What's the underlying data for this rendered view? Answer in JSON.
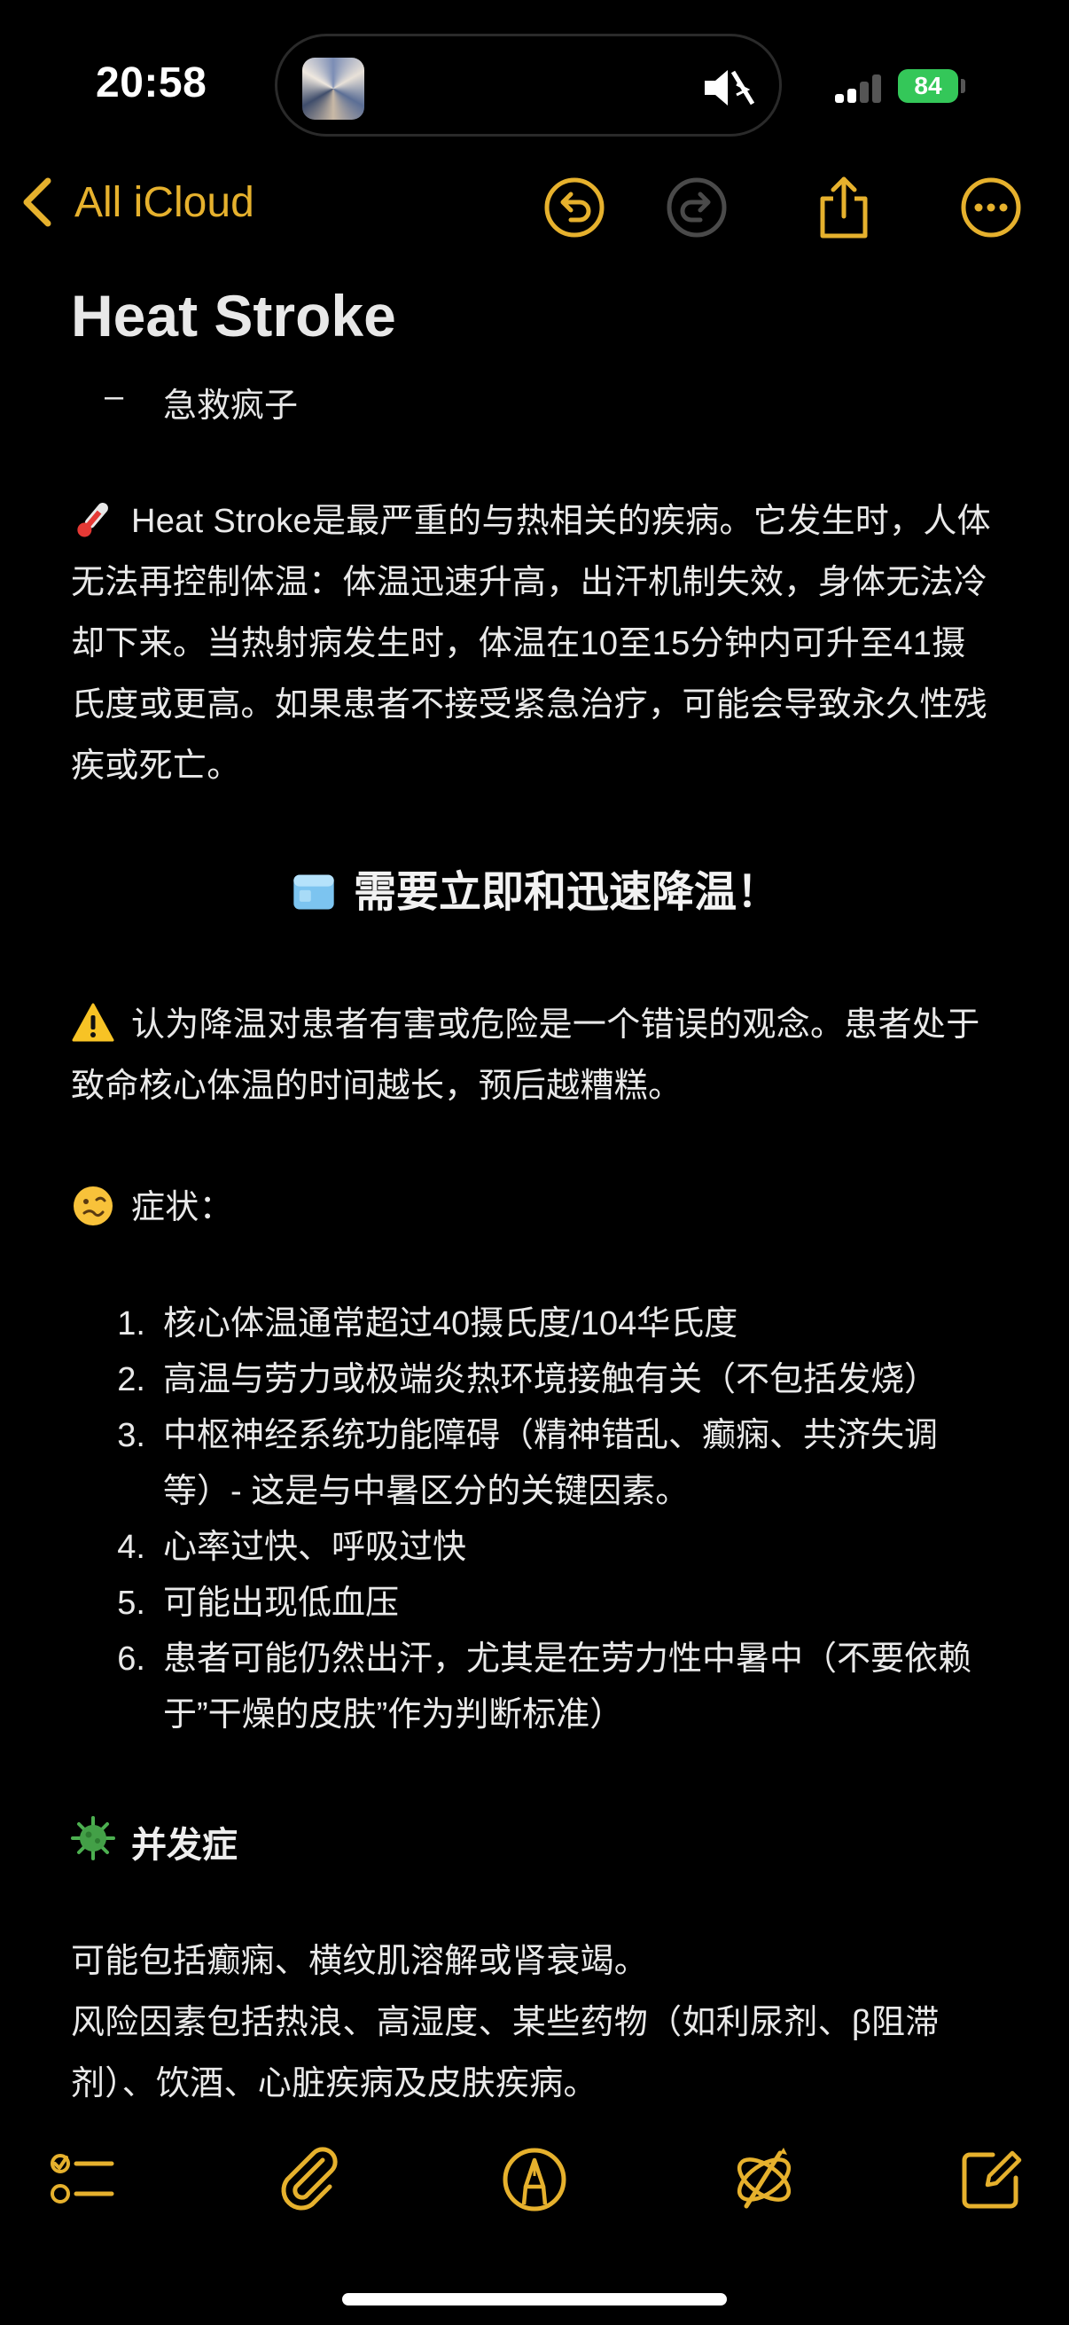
{
  "status_bar": {
    "time": "20:58",
    "battery": "84",
    "battery_color": "#34c759",
    "icons": [
      "mute-bell-icon",
      "bluetooth-icon",
      "cellular-signal-icon",
      "battery-charging-icon"
    ]
  },
  "nav": {
    "back_label": "All iCloud",
    "accent_color": "#e6b12d",
    "buttons": [
      "undo-icon",
      "redo-icon",
      "share-icon",
      "more-icon"
    ]
  },
  "note": {
    "title": "Heat Stroke",
    "subtitle_dash": "–",
    "subtitle": "急救疯子",
    "intro": "Heat Stroke是最严重的与热相关的疾病。它发生时，人体无法再控制体温：体温迅速升高，出汗机制失效，身体无法冷却下来。当热射病发生时，体温在10至15分钟内可升至41摄氏度或更高。如果患者不接受紧急治疗，可能会导致永久性残疾或死亡。",
    "intro_emoji": "thermometer-emoji",
    "cooling_heading": "需要立即和迅速降温！",
    "cooling_emoji": "ice-cube-emoji",
    "warning": "认为降温对患者有害或危险是一个错误的观念。患者处于致命核心体温的时间越长，预后越糟糕。",
    "warning_emoji": "warning-emoji",
    "symptoms_label": "症状：",
    "symptoms_emoji": "woozy-face-emoji",
    "symptoms": [
      {
        "num": "1.",
        "text": "核心体温通常超过40摄氏度/104华氏度"
      },
      {
        "num": "2.",
        "text": "高温与劳力或极端炎热环境接触有关（不包括发烧）"
      },
      {
        "num": "3.",
        "text": "中枢神经系统功能障碍（精神错乱、癫痫、共济失调等）- 这是与中暑区分的关键因素。"
      },
      {
        "num": "4.",
        "text": "心率过快、呼吸过快"
      },
      {
        "num": "5.",
        "text": "可能出现低血压"
      },
      {
        "num": "6.",
        "text": "患者可能仍然出汗，尤其是在劳力性中暑中（不要依赖于”干燥的皮肤”作为判断标准）"
      }
    ],
    "complications_label": "并发症",
    "complications_emoji": "microbe-emoji",
    "complications_text": "可能包括癫痫、横纹肌溶解或肾衰竭。",
    "risk_factors": "风险因素包括热浪、高湿度、某些药物（如利尿剂、β阻滞剂）、饮酒、心脏疾病及皮肤疾病。"
  },
  "toolbar": {
    "buttons": [
      "checklist-icon",
      "attachment-icon",
      "markup-pen-icon",
      "writing-tools-icon",
      "compose-icon"
    ]
  }
}
